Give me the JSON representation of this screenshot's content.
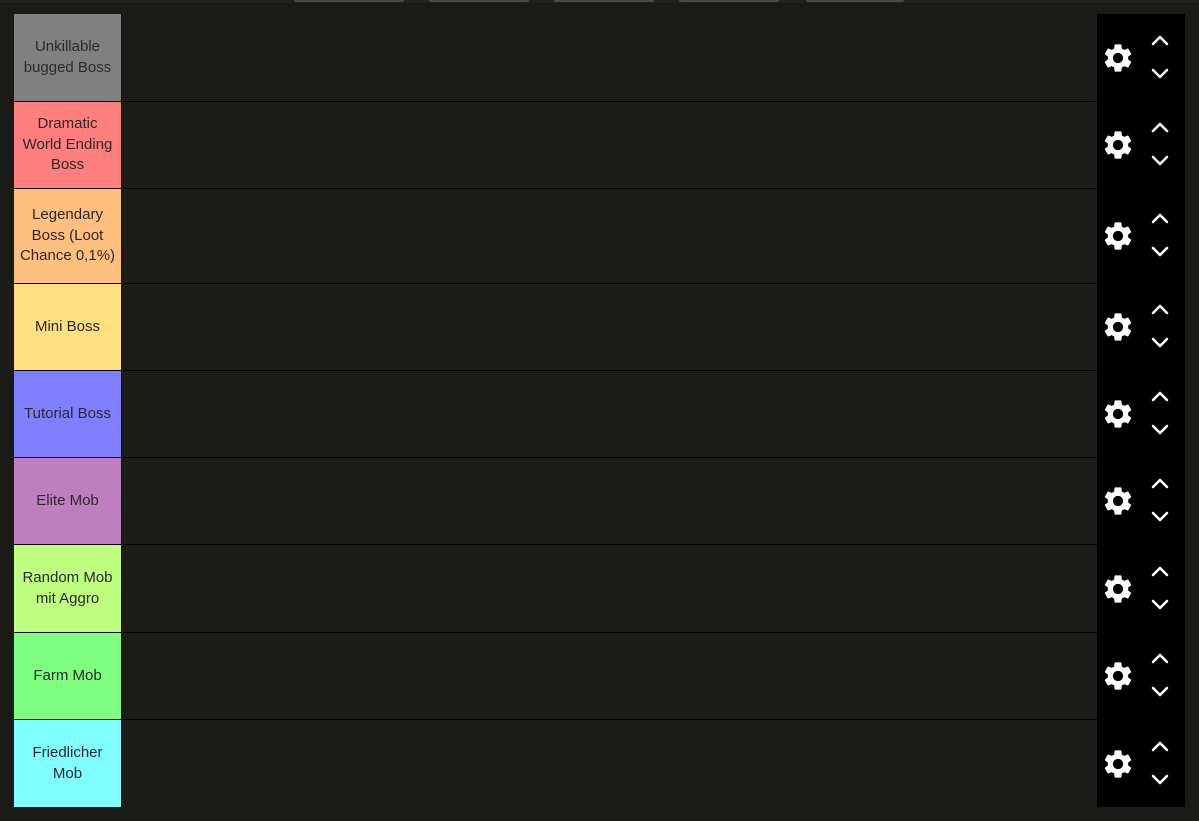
{
  "tiers": [
    {
      "label": "Unkillable bugged Boss",
      "color": "#808080"
    },
    {
      "label": "Dramatic World Ending Boss",
      "color": "#ff7f7f"
    },
    {
      "label": "Legendary Boss (Loot Chance 0,1%)",
      "color": "#ffbf7f"
    },
    {
      "label": "Mini Boss",
      "color": "#ffdf7f"
    },
    {
      "label": "Tutorial Boss",
      "color": "#7f7fff"
    },
    {
      "label": "Elite Mob",
      "color": "#bf7fbf"
    },
    {
      "label": "Random Mob mit Aggro",
      "color": "#bfff7f"
    },
    {
      "label": "Farm Mob",
      "color": "#7fff7f"
    },
    {
      "label": "Friedlicher Mob",
      "color": "#7fffff"
    }
  ],
  "icons": {
    "settings": "gear-icon",
    "move_up": "chevron-up-icon",
    "move_down": "chevron-down-icon"
  }
}
